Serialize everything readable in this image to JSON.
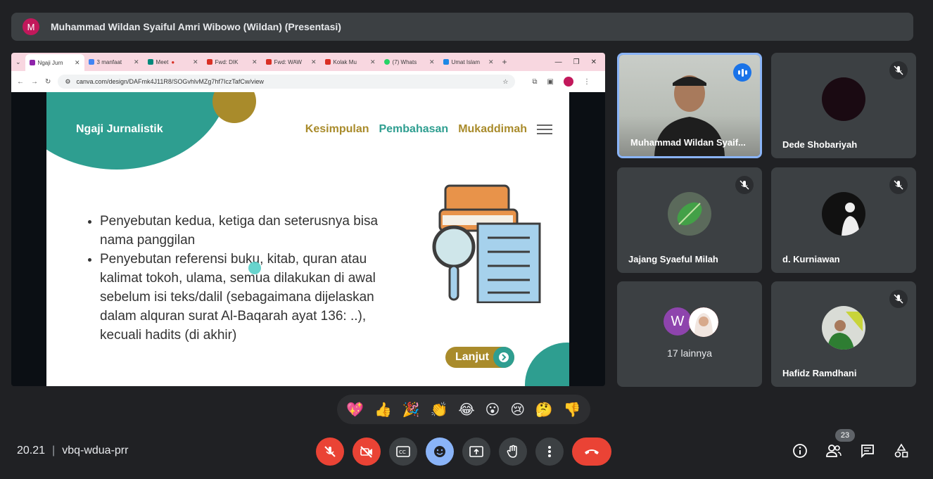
{
  "presenter": {
    "initial": "M",
    "label": "Muhammad Wildan Syaiful Amri Wibowo (Wildan) (Presentasi)"
  },
  "browser": {
    "tabs": [
      {
        "label": "Ngaji Jurn",
        "color": "#8e24aa",
        "active": true
      },
      {
        "label": "3 manfaat",
        "color": "#4285f4"
      },
      {
        "label": "Meet",
        "color": "#00897b"
      },
      {
        "label": "Fwd: DIK",
        "color": "#d93025"
      },
      {
        "label": "Fwd: WAW",
        "color": "#d93025"
      },
      {
        "label": "Kolak Mu",
        "color": "#d93025"
      },
      {
        "label": "(7) Whats",
        "color": "#25d366"
      },
      {
        "label": "Umat Islam",
        "color": "#1e88e5"
      }
    ],
    "url": "canva.com/design/DAFmk4J11R8/SOGvhlvMZg7hf7IczTafCw/view"
  },
  "slide": {
    "title": "Ngaji Jurnalistik",
    "nav": [
      "Kesimpulan",
      "Pembahasan",
      "Mukaddimah"
    ],
    "bullets": [
      "Penyebutan kedua, ketiga dan seterusnya bisa nama panggilan",
      "Penyebutan referensi buku, kitab, quran atau kalimat tokoh, ulama, semua dilakukan di awal sebelum isi teks/dalil (sebagaimana dijelaskan dalam alquran surat Al-Baqarah ayat 136: ..), kecuali hadits (di akhir)"
    ],
    "next_button": "Lanjut"
  },
  "participants": [
    {
      "name": "Muhammad Wildan Syaif...",
      "state": "speaking"
    },
    {
      "name": "Dede Shobariyah",
      "state": "muted"
    },
    {
      "name": "Jajang Syaeful Milah",
      "state": "muted"
    },
    {
      "name": "d. Kurniawan",
      "state": "muted"
    },
    {
      "name": "17 lainnya",
      "state": "group",
      "initial": "W"
    },
    {
      "name": "Hafidz Ramdhani",
      "state": "muted"
    }
  ],
  "reactions": [
    "💖",
    "👍",
    "🎉",
    "👏",
    "😂",
    "😮",
    "😢",
    "🤔",
    "👎"
  ],
  "meeting": {
    "time": "20.21",
    "separator": "|",
    "code": "vbq-wdua-prr",
    "participant_count": "23"
  },
  "colors": {
    "background": "#202124",
    "tile": "#3c4043",
    "danger": "#ea4335",
    "accent": "#8ab4f8",
    "slide_teal": "#2e9e90",
    "slide_gold": "#a98b2b"
  },
  "icons": {
    "mic": "mic-off-icon",
    "camera": "camera-off-icon",
    "captions": "captions-icon",
    "emoji": "emoji-icon",
    "present": "present-icon",
    "hand": "raise-hand-icon",
    "more": "more-vert-icon",
    "end": "end-call-icon",
    "info": "info-icon",
    "people": "people-icon",
    "chat": "chat-icon",
    "activities": "activities-icon"
  }
}
